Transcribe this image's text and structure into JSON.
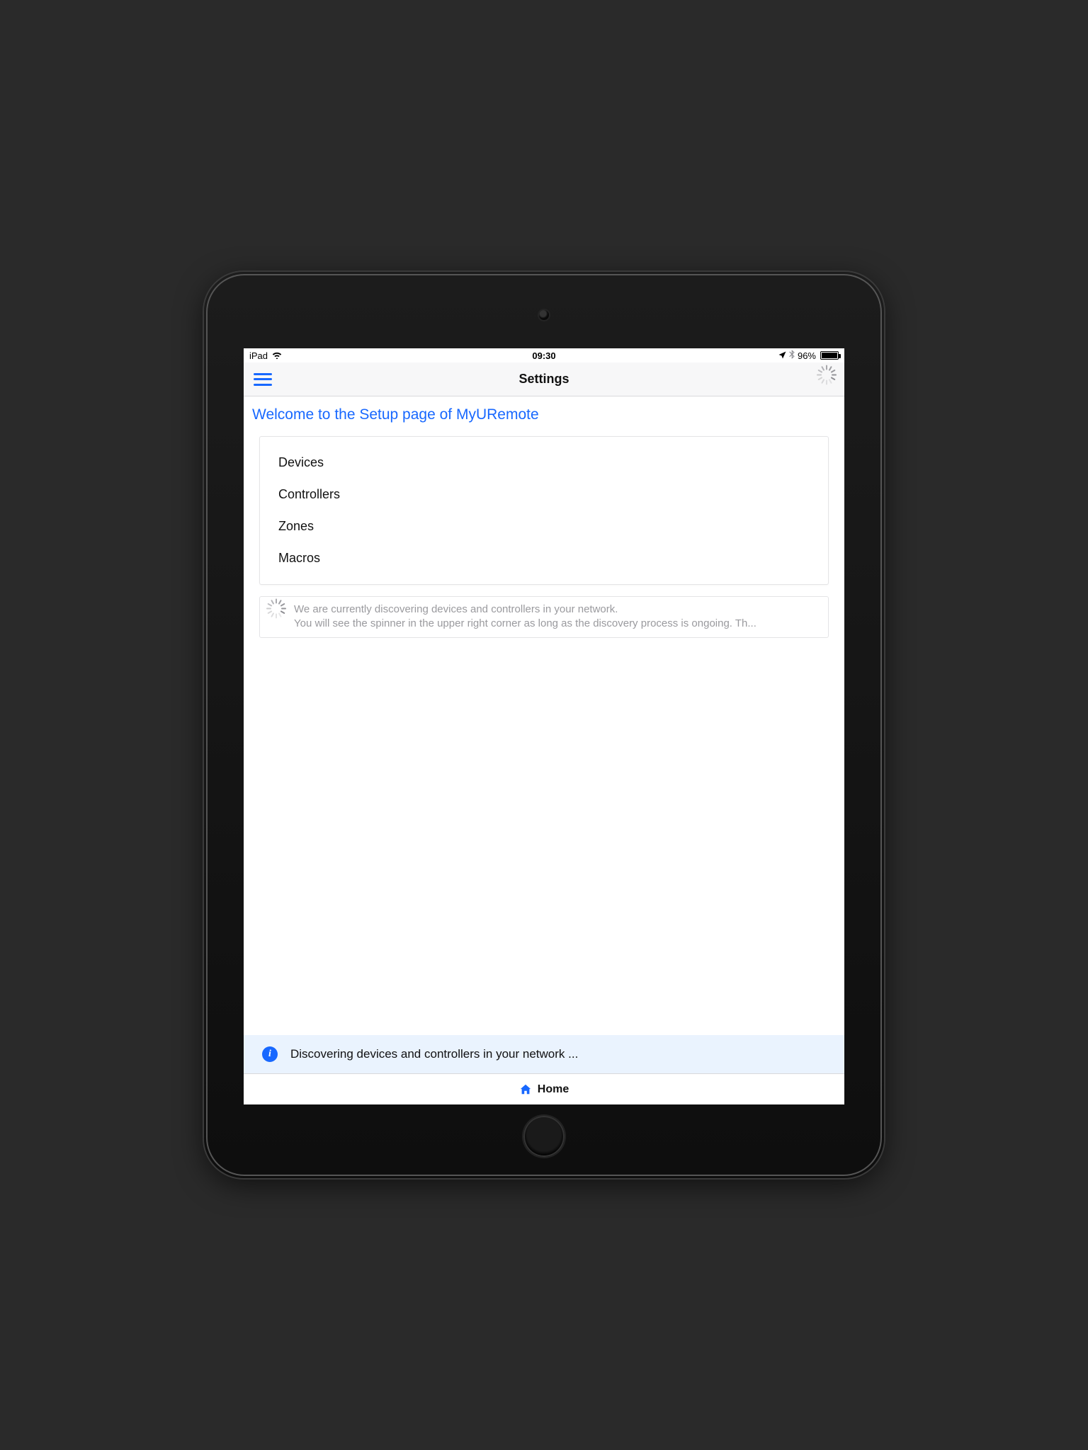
{
  "status_bar": {
    "device": "iPad",
    "time": "09:30",
    "battery_pct": "96%"
  },
  "navbar": {
    "title": "Settings"
  },
  "page": {
    "welcome": "Welcome to the Setup page of MyURemote",
    "menu": [
      "Devices",
      "Controllers",
      "Zones",
      "Macros"
    ],
    "discovery_info_line1": "We are currently discovering devices and controllers in your network.",
    "discovery_info_line2": "You will see the spinner in the upper right corner as long as the discovery process is ongoing. Th..."
  },
  "toast": {
    "message": "Discovering devices and controllers in your network ..."
  },
  "tabbar": {
    "home_label": "Home"
  }
}
